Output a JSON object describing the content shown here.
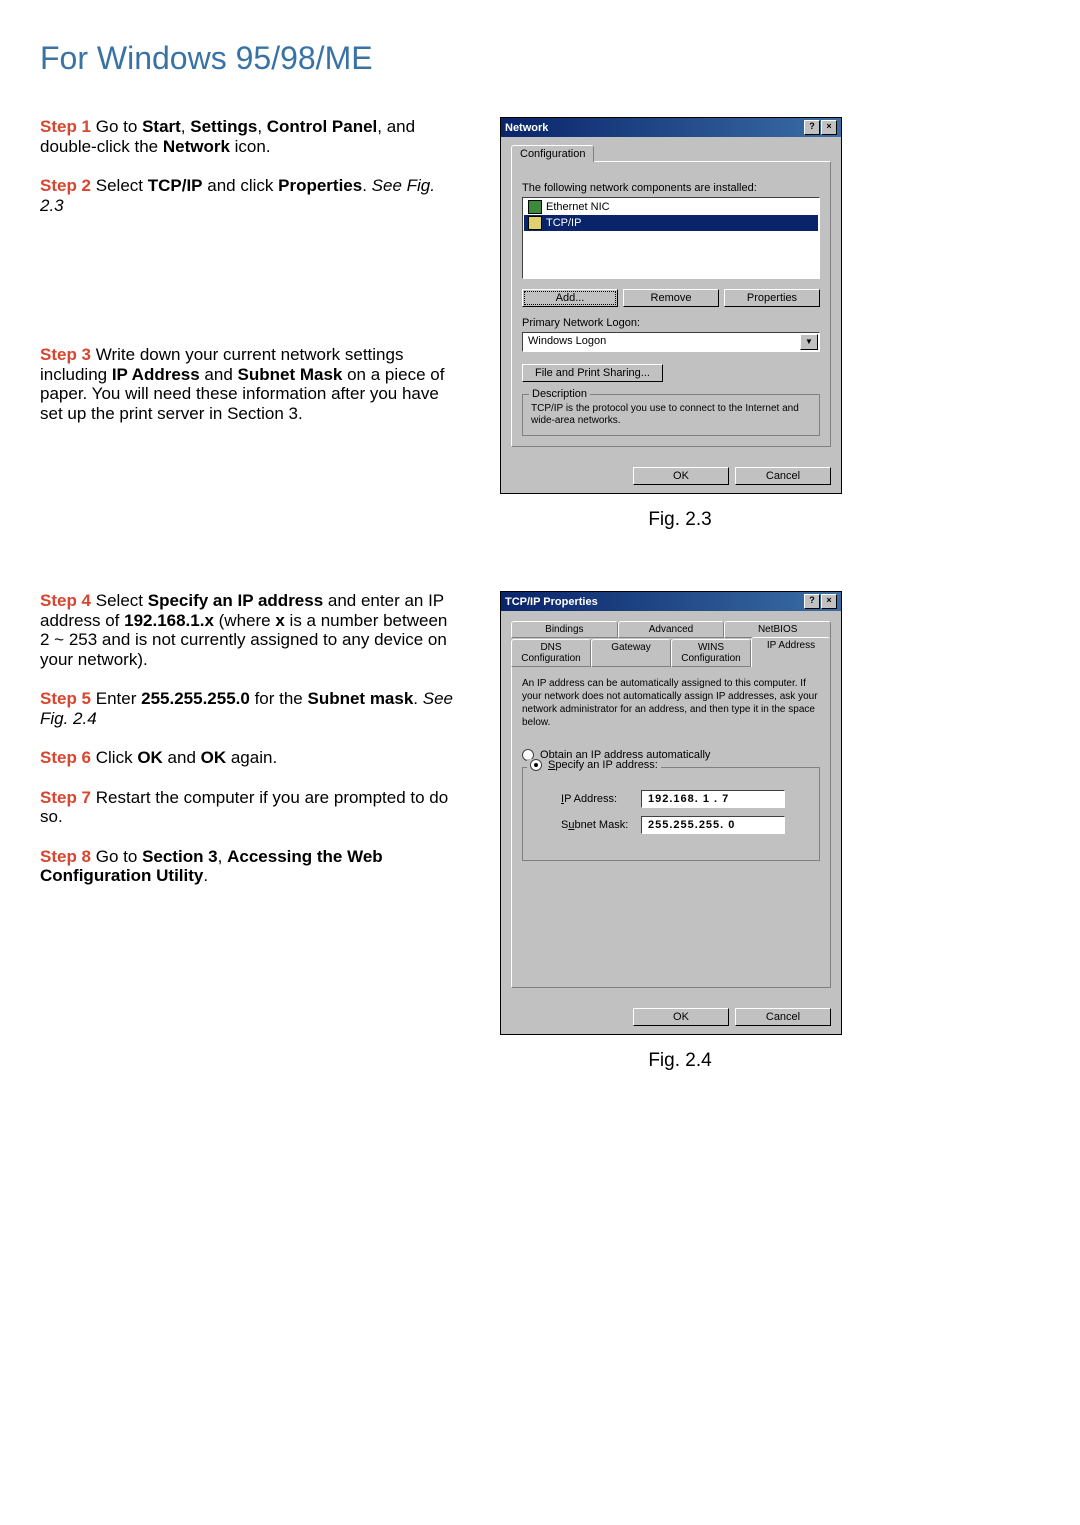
{
  "page": {
    "title": "For Windows 95/98/ME"
  },
  "steps": {
    "s1": {
      "label": "Step 1",
      "t1": " Go to ",
      "b1": "Start",
      "t2": ", ",
      "b2": "Settings",
      "t3": ", ",
      "b3": "Control Panel",
      "t4": ", and double-click the ",
      "b4": "Network",
      "t5": " icon."
    },
    "s2": {
      "label": "Step 2",
      "t1": " Select ",
      "b1": "TCP/IP",
      "t2": " and click ",
      "b2": "Properties",
      "t3": ". ",
      "i1": "See Fig. 2.3"
    },
    "s3": {
      "label": "Step 3",
      "t1": " Write down your current network settings including ",
      "b1": "IP Address",
      "t2": " and ",
      "b2": "Subnet Mask",
      "t3": " on a piece of paper. You will need these information after you have set up the print server in Section 3."
    },
    "s4": {
      "label": "Step 4",
      "t1": " Select ",
      "b1": "Specify an IP address",
      "t2": " and enter an IP address of ",
      "b2": "192.168.1.x",
      "t3": " (where ",
      "b3": "x",
      "t4": " is a number between 2 ~ 253 and is not currently assigned to any device on your network)."
    },
    "s5": {
      "label": "Step 5",
      "t1": " Enter ",
      "b1": "255.255.255.0",
      "t2": " for the ",
      "b2": "Subnet mask",
      "t3": ". ",
      "i1": "See Fig. 2.4"
    },
    "s6": {
      "label": "Step 6",
      "t1": " Click ",
      "b1": "OK",
      "t2": " and ",
      "b2": "OK",
      "t3": " again."
    },
    "s7": {
      "label": "Step 7",
      "t1": " Restart the computer if you are prompted to do so."
    },
    "s8": {
      "label": "Step 8",
      "t1": " Go to ",
      "b1": "Section 3",
      "t2": ", ",
      "b2": "Accessing the Web Configuration Utility",
      "t3": "."
    }
  },
  "fig1": {
    "caption": "Fig. 2.3",
    "title": "Network",
    "tab": "Configuration",
    "components_label": "The following network components are installed:",
    "list": {
      "item1": "Ethernet NIC",
      "item2": "TCP/IP"
    },
    "add": "Add...",
    "remove": "Remove",
    "properties": "Properties",
    "logon_label": "Primary Network Logon:",
    "logon_value": "Windows Logon",
    "share_btn": "File and Print Sharing...",
    "desc_legend": "Description",
    "desc_text": "TCP/IP is the protocol you use to connect to the Internet and wide-area networks.",
    "ok": "OK",
    "cancel": "Cancel",
    "help": "?",
    "close": "×"
  },
  "fig2": {
    "caption": "Fig. 2.4",
    "title": "TCP/IP Properties",
    "tabs_row1": {
      "t1": "Bindings",
      "t2": "Advanced",
      "t3": "NetBIOS"
    },
    "tabs_row2": {
      "t1": "DNS Configuration",
      "t2": "Gateway",
      "t3": "WINS Configuration",
      "t4": "IP Address"
    },
    "blurb": "An IP address can be automatically assigned to this computer. If your network does not automatically assign IP addresses, ask your network administrator for an address, and then type it in the space below.",
    "radio_obtain_pre": "O",
    "radio_obtain_text": "btain an IP address automatically",
    "radio_specify_pre": "S",
    "radio_specify_text": "pecify an IP address:",
    "ip_label_pre": "I",
    "ip_label_post": "P Address:",
    "mask_label_pre": "S",
    "mask_label_mid": "u",
    "mask_label_post": "bnet Mask:",
    "ip_value": "192.168. 1 . 7",
    "mask_value": "255.255.255. 0",
    "ok": "OK",
    "cancel": "Cancel",
    "help": "?",
    "close": "×"
  }
}
